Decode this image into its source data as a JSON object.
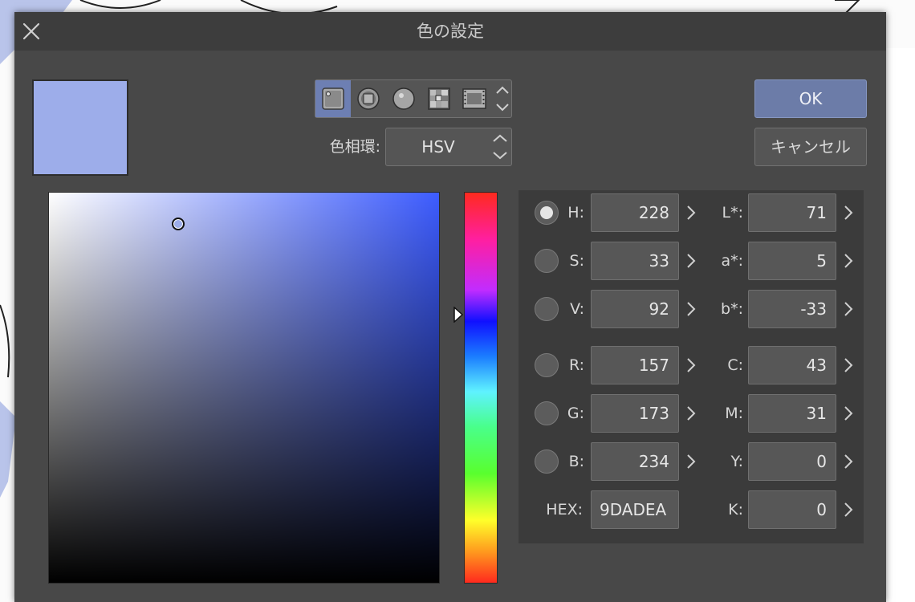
{
  "dialog": {
    "title": "色の設定",
    "ok_label": "OK",
    "cancel_label": "キャンセル",
    "hue_ring_label": "色相環:",
    "hue_ring_value": "HSV"
  },
  "icons": {
    "close": "close-icon",
    "modes": [
      "color-square-icon",
      "color-triangle-icon",
      "color-ring-icon",
      "color-grid-icon",
      "film-strip-icon"
    ],
    "scroll": "chevron-up-down-icon",
    "increment": "chevron-right-icon"
  },
  "colors": {
    "current": "#9DADEA",
    "hue_base": "#3d5cff",
    "accent": "#6c7ca8"
  },
  "picker": {
    "saturation": 0.33,
    "value": 0.92,
    "hue": 228
  },
  "values": {
    "left": [
      {
        "key": "H",
        "label": "H:",
        "value": "228",
        "selected": true
      },
      {
        "key": "S",
        "label": "S:",
        "value": "33",
        "selected": false
      },
      {
        "key": "V",
        "label": "V:",
        "value": "92",
        "selected": false
      },
      {
        "key": "R",
        "label": "R:",
        "value": "157",
        "selected": false
      },
      {
        "key": "G",
        "label": "G:",
        "value": "173",
        "selected": false
      },
      {
        "key": "B",
        "label": "B:",
        "value": "234",
        "selected": false
      },
      {
        "key": "HEX",
        "label": "HEX:",
        "value": "9DADEA"
      }
    ],
    "right": [
      {
        "key": "L",
        "label": "L*:",
        "value": "71"
      },
      {
        "key": "a",
        "label": "a*:",
        "value": "5"
      },
      {
        "key": "b",
        "label": "b*:",
        "value": "-33"
      },
      {
        "key": "C",
        "label": "C:",
        "value": "43"
      },
      {
        "key": "M",
        "label": "M:",
        "value": "31"
      },
      {
        "key": "Y",
        "label": "Y:",
        "value": "0"
      },
      {
        "key": "K",
        "label": "K:",
        "value": "0"
      }
    ]
  }
}
